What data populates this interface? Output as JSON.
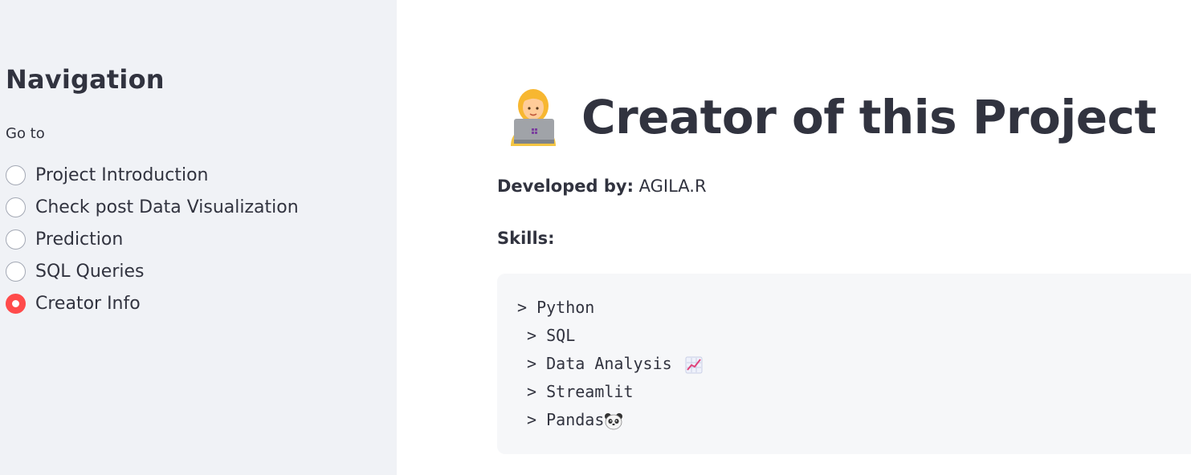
{
  "sidebar": {
    "title": "Navigation",
    "radio_label": "Go to",
    "options": [
      {
        "label": "Project Introduction",
        "checked": false
      },
      {
        "label": "Check post Data Visualization",
        "checked": false
      },
      {
        "label": "Prediction",
        "checked": false
      },
      {
        "label": "SQL Queries",
        "checked": false
      },
      {
        "label": "Creator Info",
        "checked": true
      }
    ]
  },
  "main": {
    "title_icon": "woman-technologist-icon",
    "title": "Creator of this Project",
    "developed_by_label": "Developed by:",
    "developed_by_value": " AGILA.R",
    "skills_label": "Skills:",
    "skills": [
      {
        "text": "> Python",
        "icon": ""
      },
      {
        "text": " > SQL",
        "icon": ""
      },
      {
        "text": " > Data Analysis ",
        "icon": "chart-increasing-icon"
      },
      {
        "text": " > Streamlit",
        "icon": ""
      },
      {
        "text": " > Pandas",
        "icon": "panda-icon"
      }
    ]
  },
  "colors": {
    "accent": "#ff4b4b",
    "sidebar_bg": "#f0f2f6",
    "text": "#31333f",
    "code_bg": "#f6f7f9"
  }
}
